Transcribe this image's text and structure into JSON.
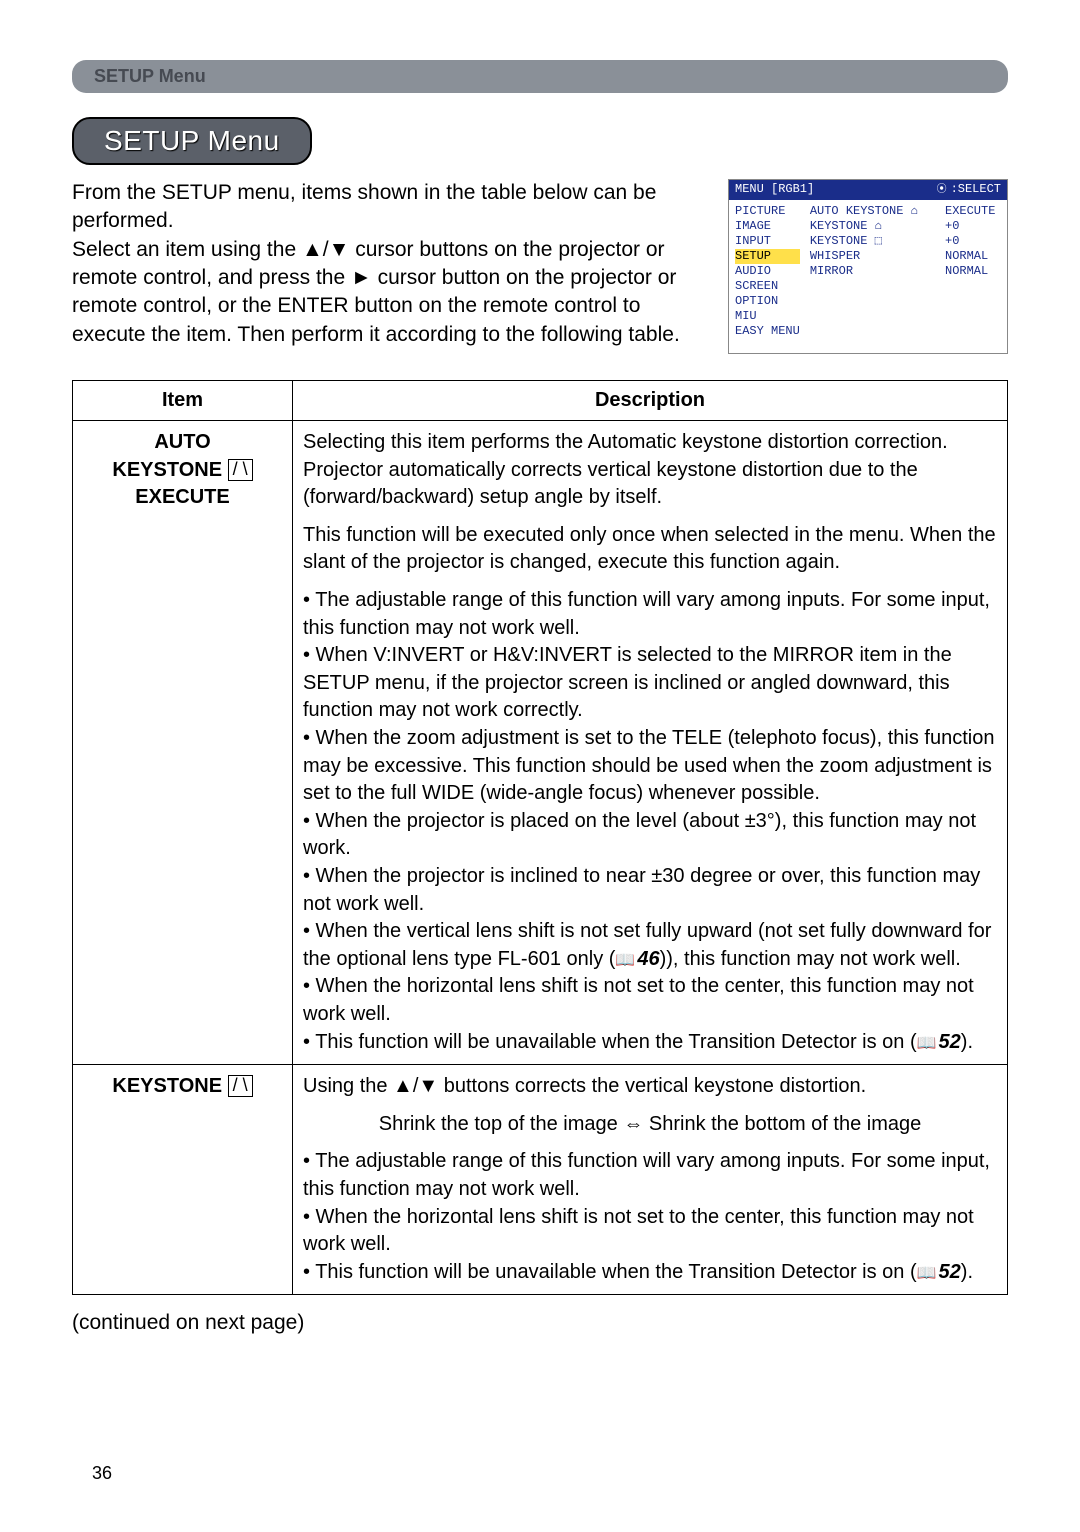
{
  "header": {
    "label": "SETUP Menu"
  },
  "title": "SETUP Menu",
  "intro": "From the SETUP menu, items shown in the table below can be performed.\nSelect an item using the ▲/▼ cursor buttons on the projector or remote control, and press the ► cursor button on the projector or remote control, or the ENTER button on the remote control to execute the item. Then perform it according to the following table.",
  "osd": {
    "menu": "MENU [RGB1]",
    "select": ":SELECT",
    "left": [
      "PICTURE",
      "IMAGE",
      "INPUT",
      "SETUP",
      "AUDIO",
      "SCREEN",
      "OPTION",
      "MIU",
      "EASY MENU"
    ],
    "activeIndex": 3,
    "right": [
      {
        "l": "AUTO KEYSTONE ⌂",
        "r": "EXECUTE"
      },
      {
        "l": "KEYSTONE ⌂",
        "r": "+0"
      },
      {
        "l": "KEYSTONE ⬚",
        "r": "+0"
      },
      {
        "l": "WHISPER",
        "r": "NORMAL"
      },
      {
        "l": "MIRROR",
        "r": "NORMAL"
      }
    ]
  },
  "table": {
    "headers": {
      "item": "Item",
      "desc": "Description"
    },
    "rows": [
      {
        "item_lines": [
          "AUTO",
          "KEYSTONE",
          "EXECUTE"
        ],
        "item_icon_after_line": 1,
        "desc": [
          {
            "text": "Selecting this item performs the Automatic keystone distortion correction. Projector automatically corrects vertical keystone distortion due to the (forward/backward) setup angle by itself."
          },
          {
            "text": "This function will be executed only once when selected in the menu. When the slant of the projector is changed, execute this function again."
          },
          {
            "html": "• The adjustable range of this function will vary among inputs. For some input, this function may not work well.<br>• When V:INVERT or H&V:INVERT is selected to the MIRROR item in the SETUP menu, if the projector screen is inclined or angled downward, this function may not work correctly.<br>• When the zoom adjustment is set to the TELE (telephoto focus), this function may be excessive. This function should be used when the zoom adjustment is set to the full WIDE (wide-angle focus) whenever possible.<br>• When the projector is placed on the level (about ±3°), this function may not work.<br>• When the projector is inclined to near ±30 degree or over, this function may not work well.<br>• When the vertical lens shift is not set fully upward (not set fully downward for the optional lens type FL-601 only (<span class='ref'><span class='book-icon'></span><span class='pg'>46</span></span>)), this function may not work well.<br>• When the horizontal lens shift is not set to the center, this function may not work well.<br>• This function will be unavailable when the Transition Detector is on (<span class='ref'><span class='book-icon'></span><span class='pg'>52</span></span>)."
          }
        ]
      },
      {
        "item_lines": [
          "KEYSTONE"
        ],
        "item_icon_after_line": 0,
        "desc": [
          {
            "text": "Using the ▲/▼ buttons corrects the vertical keystone distortion."
          },
          {
            "center": true,
            "text": "Shrink the top of the image ⇔ Shrink the bottom of the image"
          },
          {
            "html": "• The adjustable range of this function will vary among inputs. For some input, this function may not work well.<br>• When the horizontal lens shift is not set to the center, this function may not work well.<br>• This function will be unavailable when the Transition Detector is on (<span class='ref'><span class='book-icon'></span><span class='pg'>52</span></span>)."
          }
        ]
      }
    ]
  },
  "continued": "(continued on next page)",
  "pagenum": "36"
}
